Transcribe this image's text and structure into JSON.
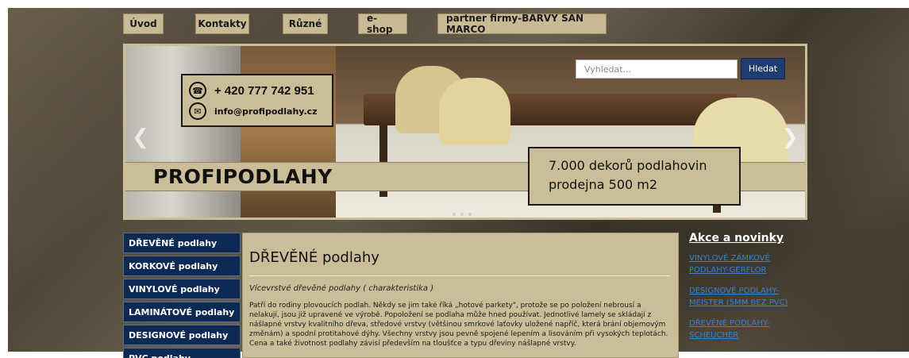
{
  "nav": {
    "items": [
      {
        "label": "Úvod"
      },
      {
        "label": "Kontakty"
      },
      {
        "label": "Různé"
      },
      {
        "label": "e-shop"
      },
      {
        "label": "partner firmy-BARVY SAN MARCO"
      }
    ]
  },
  "search": {
    "placeholder": "Vyhledat...",
    "button_label": "Hledat"
  },
  "contact": {
    "phone": "+ 420 777 742 951",
    "email": "info@profipodlahy.cz"
  },
  "banner": {
    "brand": "PROFIPODLAHY",
    "promo_line1": "7.000 dekorů podlahovin",
    "promo_line2": "prodejna 500 m2"
  },
  "menu": {
    "items": [
      {
        "label": "DŘEVĚNÉ podlahy"
      },
      {
        "label": "KORKOVÉ podlahy"
      },
      {
        "label": "VINYLOVÉ podlahy"
      },
      {
        "label": "LAMINÁTOVÉ podlahy"
      },
      {
        "label": "DESIGNOVÉ podlahy"
      },
      {
        "label": "PVC podlahy"
      }
    ]
  },
  "content": {
    "title": "DŘEVĚNÉ podlahy",
    "subtitle": "Vícevrstvé dřevěné podlahy ( charakteristika )",
    "text": "Patří do rodiny plovoucích podlah. Někdy se jim také říká „hotové parkety\", protože se po položení nebrousí a nelakují, jsou již upravené ve výrobě. Popoložení se podlaha může hned používat. Jednotlivé lamely se skládají z nášlapné vrstvy kvalitního dřeva, středové vrstvy (většinou smrkové laťovky uložené napříč, která brání objemovým změnám) a spodní protitahové dýhy. Všechny vrstvy jsou pevně spojené lepením a lisováním při vysokých teplotách. Cena a také životnost podlahy závisí především na tloušťce a typu dřeviny nášlapné vrstvy."
  },
  "news": {
    "title": "Akce a novinky",
    "links": [
      {
        "label": "VINYLOVÉ ZÁMKOVÉ PODLAHY-GERFLOR"
      },
      {
        "label": "DESIGNOVÉ PODLAHY-MEISTER (5mm bez PVC)"
      },
      {
        "label": "DŘEVĚNÉ PODLAHY-SCHEUCHER"
      }
    ]
  },
  "colors": {
    "tan": "#cbbd97",
    "navy": "#0d2a55",
    "link": "#3a7fd0"
  }
}
